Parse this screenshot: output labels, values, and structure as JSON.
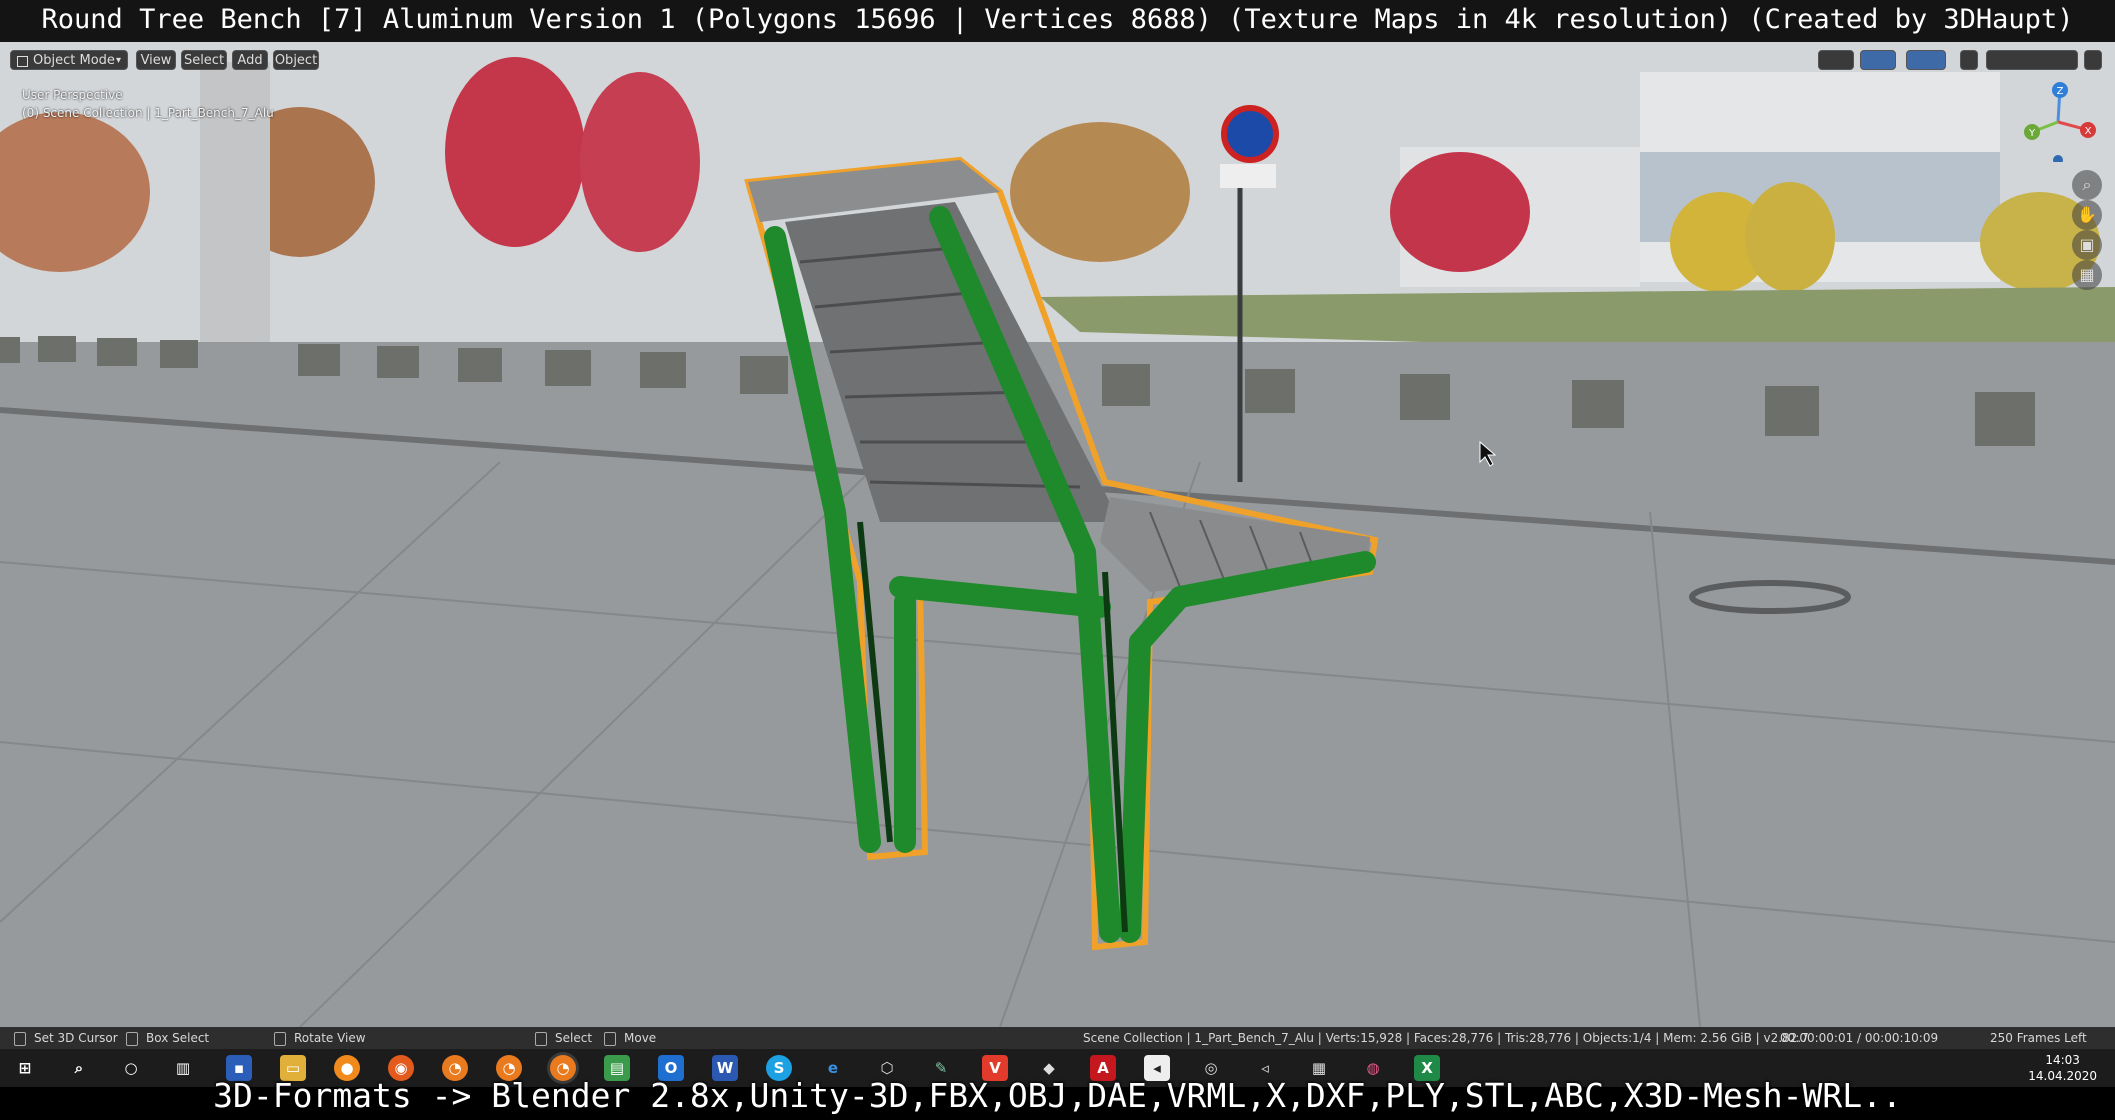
{
  "window": {
    "title": "Round Tree Bench [7] Aluminum Version 1 (Polygons 15696 | Vertices 8688) (Texture Maps in 4k resolution) (Created by 3DHaupt)"
  },
  "viewport": {
    "mode": "Object Mode",
    "menus": [
      "View",
      "Select",
      "Add",
      "Object"
    ],
    "info_line1": "User Perspective",
    "info_line2": "(0) Scene Collection | 1_Part_Bench_7_Alu",
    "gizmo_axes": [
      "Z",
      "Y",
      "X"
    ],
    "nav_icons": [
      "zoom-icon",
      "hand-pan-icon",
      "camera-icon",
      "grid-icon"
    ]
  },
  "status_bar": {
    "set_cursor": "Set 3D Cursor",
    "box_select": "Box Select",
    "rotate_view": "Rotate View",
    "select": "Select",
    "move": "Move",
    "scene_stats": "Scene Collection | 1_Part_Bench_7_Alu | Verts:15,928 | Faces:28,776 | Tris:28,776 | Objects:1/4 | Mem: 2.56 GiB | v2.82.7",
    "timecode": "00:00:00:01 / 00:00:10:09",
    "frames": "250 Frames Left"
  },
  "taskbar": {
    "apps": [
      "start",
      "search",
      "cortana",
      "task-view",
      "save",
      "explorer",
      "blender-orange",
      "firefox",
      "blender",
      "blender",
      "blender-active",
      "image-viewer",
      "outlook",
      "word",
      "skype",
      "edge",
      "3d-viewer",
      "sketch",
      "vivaldi",
      "inkscape",
      "acrobat",
      "media",
      "obs",
      "mail",
      "calc",
      "maps",
      "excel"
    ],
    "time": "14:03",
    "date": "14.04.2020"
  },
  "caption": {
    "text": "3D-Formats -> Blender 2.8x,Unity-3D,FBX,OBJ,DAE,VRML,X,DXF,PLY,STL,ABC,X3D-Mesh-WRL.."
  },
  "colors": {
    "bench_frame": "#1f8a2b",
    "bench_slats": "#7c7d7f",
    "selection_outline": "#f0a12a",
    "ui_panel": "#2e2e2e"
  }
}
